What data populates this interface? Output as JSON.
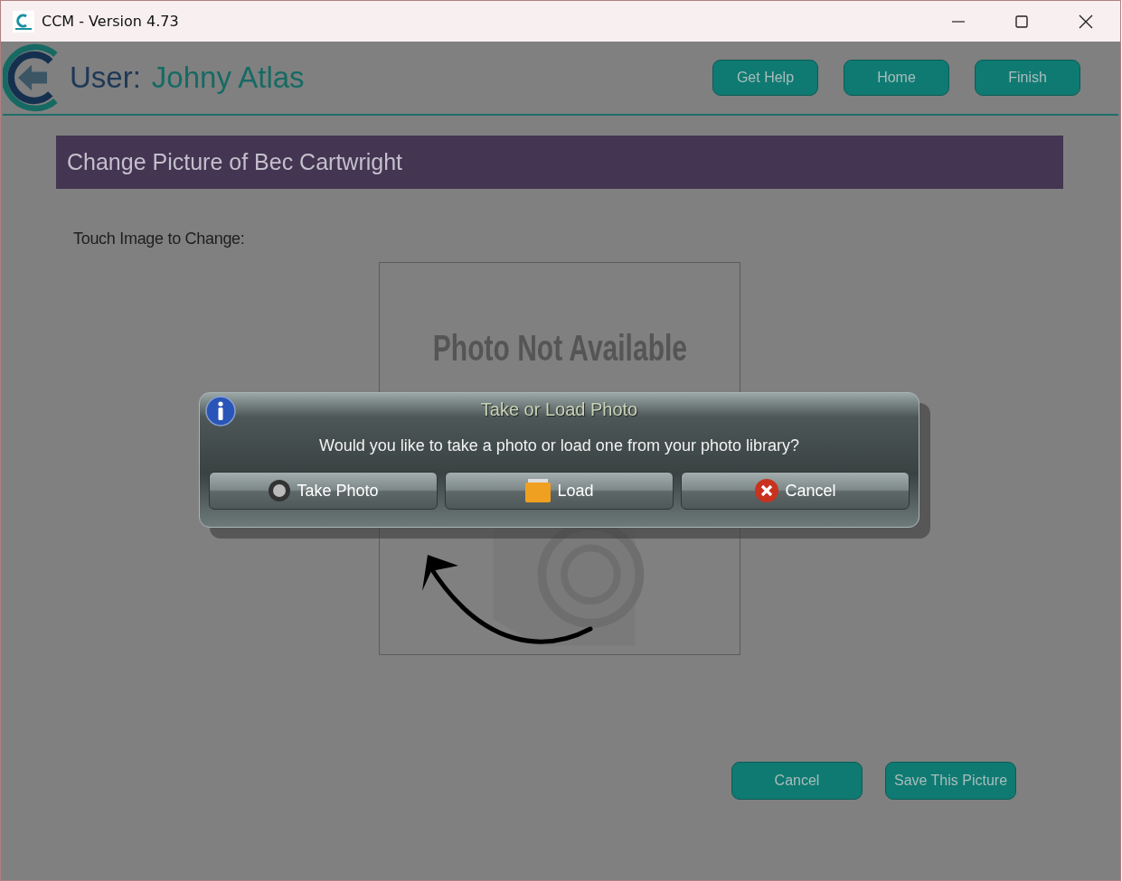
{
  "window": {
    "title": "CCM - Version 4.73"
  },
  "header": {
    "user_label": "User:",
    "user_name": "Johny Atlas",
    "buttons": [
      "Get Help",
      "Home",
      "Finish"
    ]
  },
  "banner": {
    "title": "Change Picture of Bec Cartwright"
  },
  "instruction": "Touch Image to Change:",
  "photo": {
    "placeholder_text": "Photo Not Available"
  },
  "dialog": {
    "title": "Take or Load Photo",
    "message": "Would you like to take a photo or load one from your photo library?",
    "buttons": [
      {
        "kind": "take",
        "label": "Take Photo"
      },
      {
        "kind": "load",
        "label": "Load"
      },
      {
        "kind": "cancel",
        "label": "Cancel"
      }
    ]
  },
  "footer_buttons": [
    "Cancel",
    "Save This Picture"
  ]
}
